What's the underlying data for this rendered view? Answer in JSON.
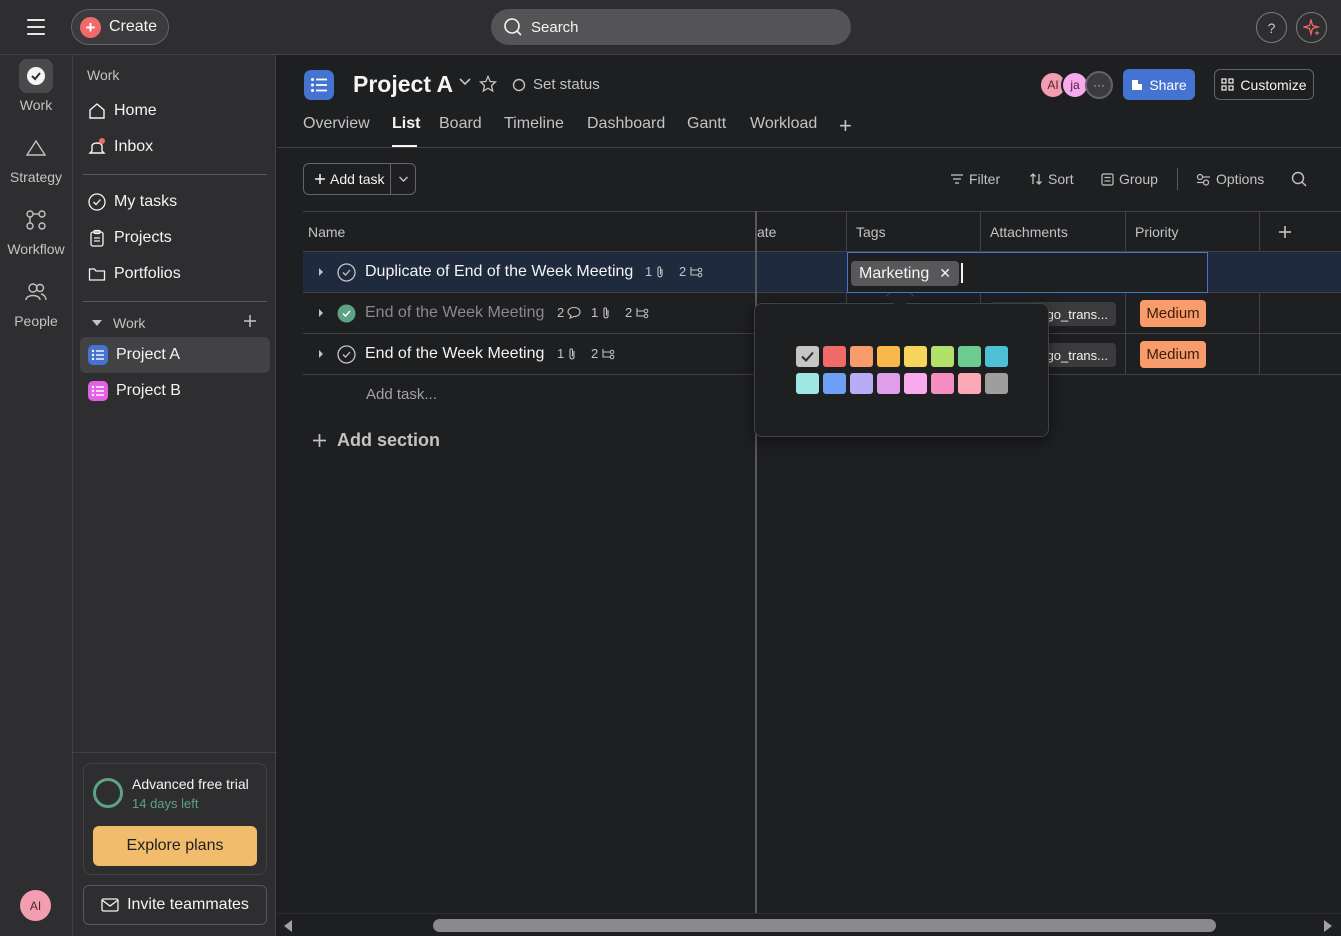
{
  "topbar": {
    "create_label": "Create",
    "search_placeholder": "Search",
    "help_label": "?"
  },
  "rail": {
    "items": [
      {
        "label": "Work"
      },
      {
        "label": "Strategy"
      },
      {
        "label": "Workflow"
      },
      {
        "label": "People"
      }
    ],
    "avatar_initials": "AI"
  },
  "sidebar": {
    "section_work": "Work",
    "home": "Home",
    "inbox": "Inbox",
    "my_tasks": "My tasks",
    "projects": "Projects",
    "portfolios": "Portfolios",
    "team_work": "Work",
    "project_a": "Project A",
    "project_b": "Project B",
    "trial_title": "Advanced free trial",
    "trial_days": "14 days left",
    "explore_label": "Explore plans",
    "invite_label": "Invite teammates"
  },
  "project": {
    "title": "Project A",
    "set_status": "Set status",
    "tabs": [
      "Overview",
      "List",
      "Board",
      "Timeline",
      "Dashboard",
      "Gantt",
      "Workload"
    ],
    "active_tab": "List",
    "avatars": [
      "AI",
      "ja"
    ],
    "share_label": "Share",
    "customize_label": "Customize"
  },
  "toolbar": {
    "add_task": "Add task",
    "filter": "Filter",
    "sort": "Sort",
    "group": "Group",
    "options": "Options"
  },
  "grid": {
    "columns": {
      "name": "Name",
      "date": "ate",
      "tags": "Tags",
      "attachments": "Attachments",
      "priority": "Priority"
    },
    "rows": [
      {
        "name": "Duplicate of End of the Week Meeting",
        "completed": false,
        "comments": "",
        "attachments": "1",
        "subtasks": "2",
        "tag": "Marketing",
        "attachment_file": "",
        "priority": ""
      },
      {
        "name": "End of the Week Meeting",
        "completed": true,
        "comments": "2",
        "attachments": "1",
        "subtasks": "2",
        "tag": "",
        "attachment_file": "go_trans...",
        "priority": "Medium"
      },
      {
        "name": "End of the Week Meeting",
        "completed": false,
        "comments": "",
        "attachments": "1",
        "subtasks": "2",
        "tag": "",
        "attachment_file": "go_trans...",
        "priority": "Medium"
      }
    ],
    "add_task_placeholder": "Add task...",
    "add_section": "Add section"
  },
  "tag_editor": {
    "chip_label": "Marketing",
    "selected_color": "#c7c4c4",
    "colors_row1": [
      "#c7c4c4",
      "#f06a6a",
      "#f89c6c",
      "#f8b84a",
      "#f5d65b",
      "#b3df6b",
      "#6ccb8e",
      "#4fbfd6"
    ],
    "colors_row2": [
      "#9ee7e3",
      "#6d9ff7",
      "#b8acf6",
      "#e09ee8",
      "#f9aaef",
      "#f48ec1",
      "#fca8b6",
      "#9e9e9e"
    ]
  },
  "colors": {
    "accent_blue": "#4573d2",
    "priority_medium": "#f89c6c",
    "trial_green": "#5da283"
  }
}
